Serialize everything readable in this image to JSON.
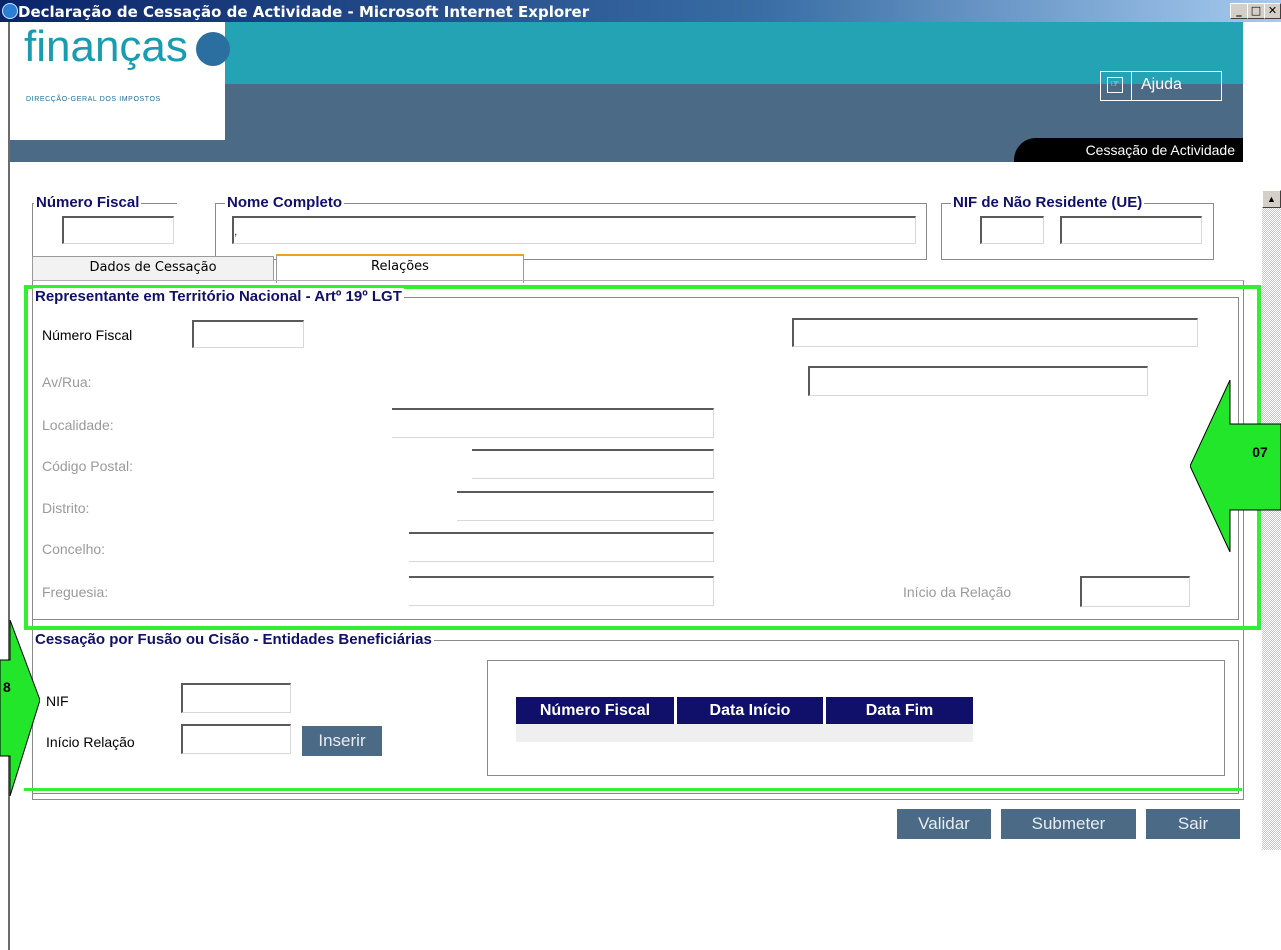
{
  "window": {
    "title": "Declaração de Cessação de Actividade - Microsoft Internet Explorer",
    "buttons": [
      "_",
      "🗗",
      "✕"
    ]
  },
  "banner": {
    "logo_text": "finanças",
    "logo_subtitle": "DIRECÇÃO-GERAL DOS IMPOSTOS",
    "help_label": "Ajuda",
    "section_title": "Cessação de Actividade",
    "colors": {
      "teal": "#23a3b4",
      "slate": "#4b6a86"
    }
  },
  "header_fields": {
    "numero_fiscal_legend": "Número Fiscal",
    "nome_completo_legend": "Nome Completo",
    "nome_completo_value": ",",
    "nif_nao_residente_legend": "NIF de Não Residente (UE)"
  },
  "tabs": [
    {
      "label": "Dados de Cessação",
      "active": false
    },
    {
      "label": "Relações",
      "active": true
    }
  ],
  "representante": {
    "legend": "Representante em Território Nacional - Artº 19º LGT",
    "numero_fiscal_label": "Número Fiscal",
    "av_rua_label": "Av/Rua:",
    "localidade_label": "Localidade:",
    "codigo_postal_label": "Código Postal:",
    "distrito_label": "Distrito:",
    "concelho_label": "Concelho:",
    "freguesia_label": "Freguesia:",
    "inicio_relacao_label": "Início da Relação"
  },
  "fusao": {
    "legend": "Cessação por Fusão ou Cisão - Entidades Beneficiárias",
    "nif_label": "NIF",
    "inicio_relacao_label": "Início Relação",
    "inserir_label": "Inserir",
    "table_headers": [
      "Número Fiscal",
      "Data Início",
      "Data Fim"
    ]
  },
  "actions": {
    "validar": "Validar",
    "submeter": "Submeter",
    "sair": "Sair"
  },
  "annotations": {
    "arrow_07": "07",
    "arrow_08": "8",
    "highlight_color": "#33ee33"
  }
}
